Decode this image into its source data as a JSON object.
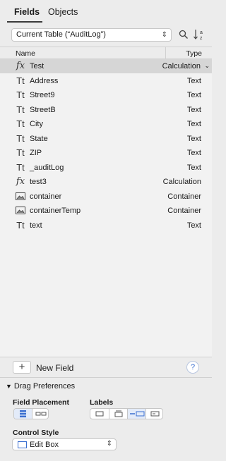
{
  "tabs": [
    {
      "label": "Fields",
      "active": true
    },
    {
      "label": "Objects",
      "active": false
    }
  ],
  "table_select": {
    "value": "Current Table (“AuditLog”)"
  },
  "toolbar": {
    "icons": [
      "search-icon",
      "sort-az-icon"
    ]
  },
  "columns": {
    "name": "Name",
    "type": "Type"
  },
  "fields": [
    {
      "icon": "fx",
      "name": "Test",
      "type": "Calculation",
      "selected": true
    },
    {
      "icon": "Tt",
      "name": "Address",
      "type": "Text"
    },
    {
      "icon": "Tt",
      "name": "Street9",
      "type": "Text"
    },
    {
      "icon": "Tt",
      "name": "StreetB",
      "type": "Text"
    },
    {
      "icon": "Tt",
      "name": "City",
      "type": "Text"
    },
    {
      "icon": "Tt",
      "name": "State",
      "type": "Text"
    },
    {
      "icon": "Tt",
      "name": "ZIP",
      "type": "Text"
    },
    {
      "icon": "Tt",
      "name": "_auditLog",
      "type": "Text"
    },
    {
      "icon": "fx",
      "name": "test3",
      "type": "Calculation"
    },
    {
      "icon": "img",
      "name": "container",
      "type": "Container"
    },
    {
      "icon": "img",
      "name": "containerTemp",
      "type": "Container"
    },
    {
      "icon": "Tt",
      "name": "text",
      "type": "Text"
    }
  ],
  "new_field": {
    "plus": "+",
    "label": "New Field",
    "help": "?"
  },
  "drag_prefs": {
    "title": "Drag Preferences",
    "field_placement_label": "Field Placement",
    "labels_label": "Labels",
    "control_style_label": "Control Style",
    "control_style_value": "Edit Box"
  },
  "colors": {
    "accent": "#3b6fd0",
    "selected_row": "#d6d6d6"
  }
}
